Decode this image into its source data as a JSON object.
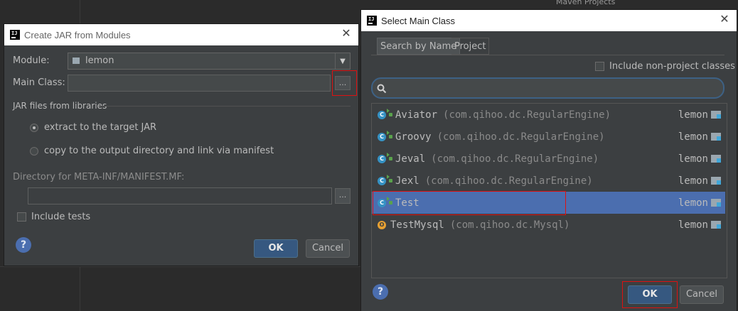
{
  "background": {
    "panel_label": "Maven Projects"
  },
  "left_dialog": {
    "title": "Create JAR from Modules",
    "module_label": "Module:",
    "module_value": "lemon",
    "main_class_label": "Main Class:",
    "main_class_value": "",
    "browse_label": "...",
    "libraries_group": "JAR files from libraries",
    "radio_extract": "extract to the target JAR",
    "radio_copy": "copy to the output directory and link via manifest",
    "manifest_dir_label": "Directory for META-INF/MANIFEST.MF:",
    "manifest_dir_value": "",
    "include_tests_label": "Include tests",
    "ok_label": "OK",
    "cancel_label": "Cancel",
    "help_label": "?"
  },
  "right_dialog": {
    "title": "Select Main Class",
    "tabs": [
      "Search by Name",
      "Project"
    ],
    "include_non_project_label": "Include non-project classes",
    "search_value": "",
    "rows": [
      {
        "name": "Aviator",
        "package": "(com.qihoo.dc.RegularEngine)",
        "module": "lemon",
        "icon": "class-run-icon",
        "selected": false
      },
      {
        "name": "Groovy",
        "package": "(com.qihoo.dc.RegularEngine)",
        "module": "lemon",
        "icon": "class-run-icon",
        "selected": false
      },
      {
        "name": "Jeval",
        "package": "(com.qihoo.dc.RegularEngine)",
        "module": "lemon",
        "icon": "class-run-icon",
        "selected": false
      },
      {
        "name": "Jexl",
        "package": "(com.qihoo.dc.RegularEngine)",
        "module": "lemon",
        "icon": "class-run-icon",
        "selected": false
      },
      {
        "name": "Test",
        "package": "",
        "module": "lemon",
        "icon": "class-run-icon",
        "selected": true
      },
      {
        "name": "TestMysql",
        "package": "(com.qihoo.dc.Mysql)",
        "module": "lemon",
        "icon": "object-icon",
        "selected": false
      }
    ],
    "ok_label": "OK",
    "cancel_label": "Cancel",
    "help_label": "?"
  },
  "colors": {
    "selection": "#4b6eaf",
    "highlight_box": "#dd1111",
    "default_button": "#365880"
  }
}
